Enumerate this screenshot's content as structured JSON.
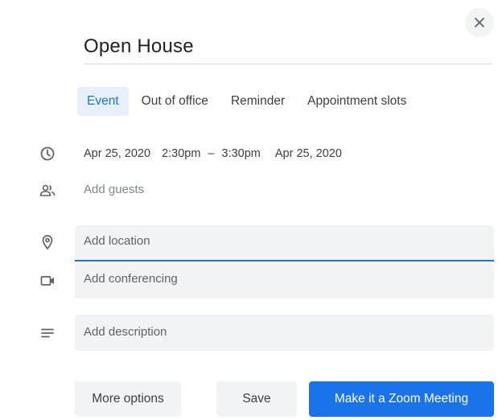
{
  "dialog": {
    "title": "Open House",
    "close_icon": "close-icon"
  },
  "tabs": [
    {
      "label": "Event",
      "active": true
    },
    {
      "label": "Out of office",
      "active": false
    },
    {
      "label": "Reminder",
      "active": false
    },
    {
      "label": "Appointment slots",
      "active": false
    }
  ],
  "datetime": {
    "icon": "clock-icon",
    "start_date": "Apr 25, 2020",
    "start_time": "2:30pm",
    "separator": "–",
    "end_time": "3:30pm",
    "end_date": "Apr 25, 2020"
  },
  "guests": {
    "icon": "people-icon",
    "placeholder": "Add guests"
  },
  "location": {
    "icon": "location-pin-icon",
    "placeholder": "Add location"
  },
  "conferencing": {
    "icon": "video-camera-icon",
    "placeholder": "Add conferencing"
  },
  "description": {
    "icon": "notes-icon",
    "placeholder": "Add description"
  },
  "actions": {
    "more_options": "More options",
    "save": "Save",
    "zoom": "Make it a Zoom Meeting"
  },
  "colors": {
    "accent": "#1a73e8",
    "field_bg": "#f1f3f4",
    "text": "#3c4043"
  }
}
